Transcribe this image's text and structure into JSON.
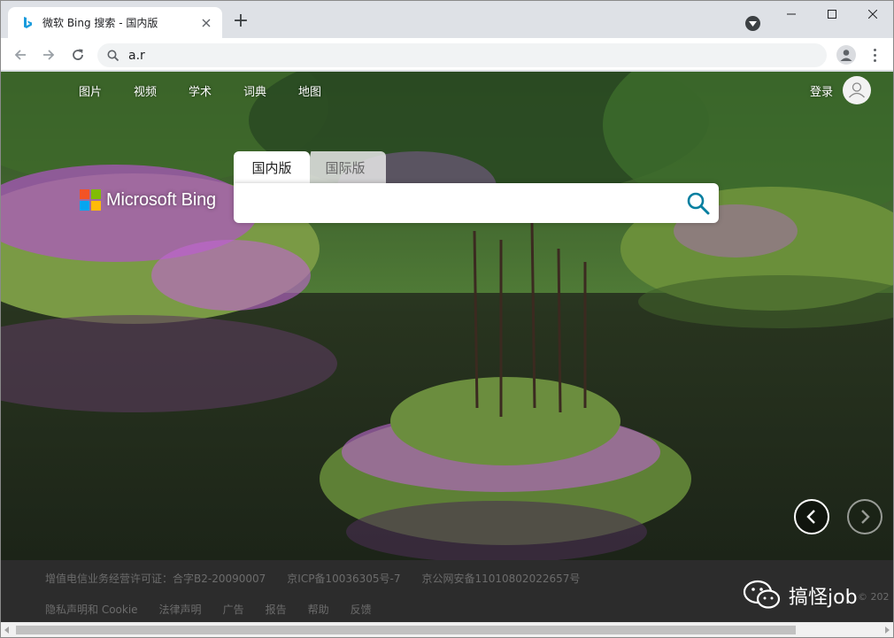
{
  "browser": {
    "tab_title": "微软 Bing 搜索 - 国内版",
    "new_tab_label": "+",
    "address": "a.r"
  },
  "page": {
    "nav": [
      "图片",
      "视频",
      "学术",
      "词典",
      "地图"
    ],
    "signin_label": "登录",
    "logo_text": "Microsoft Bing",
    "search_tabs": {
      "domestic": "国内版",
      "international": "国际版"
    },
    "search_value": ""
  },
  "footer": {
    "row1": [
      "增值电信业务经营许可证：合字B2-20090007",
      "京ICP备10036305号-7",
      "京公网安备11010802022657号"
    ],
    "row2": [
      "隐私声明和 Cookie",
      "法律声明",
      "广告",
      "报告",
      "帮助",
      "反馈"
    ],
    "copyright": "© 202",
    "watermark": "搞怪job"
  },
  "colors": {
    "accent": "#067fa0",
    "logo_red": "#f35325",
    "logo_green": "#81bc06",
    "logo_blue": "#05a6f0",
    "logo_yellow": "#ffba08"
  }
}
